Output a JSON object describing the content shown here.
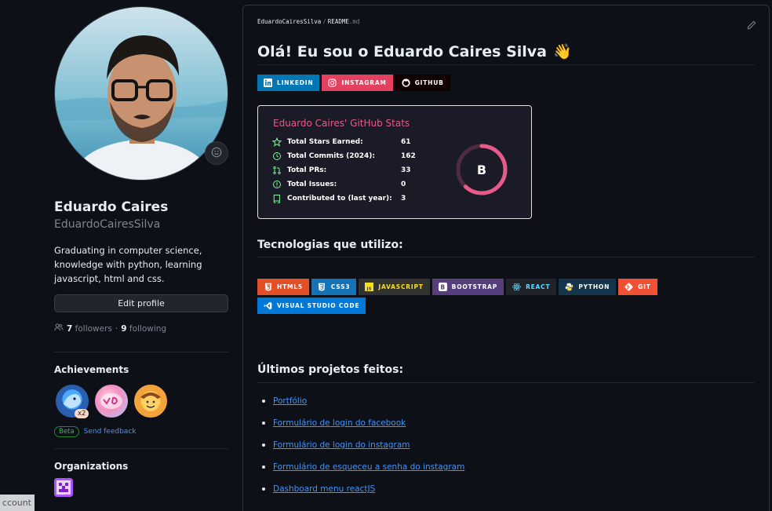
{
  "profile": {
    "full_name": "Eduardo Caires",
    "login": "EduardoCairesSilva",
    "bio": "Graduating in computer science, knowledge with python, learning javascript, html and css.",
    "edit_label": "Edit profile",
    "followers_count": "7",
    "followers_label": "followers",
    "following_count": "9",
    "following_label": "following",
    "separator": "·"
  },
  "achievements": {
    "title": "Achievements",
    "multiplier": "x2",
    "beta_label": "Beta",
    "feedback_label": "Send feedback"
  },
  "organizations": {
    "title": "Organizations"
  },
  "tooltip_fragment": "ccount",
  "readme": {
    "path_user": "EduardoCairesSilva",
    "path_sep": "/",
    "path_file": "README",
    "path_ext": ".md",
    "heading": "Olá! Eu sou o Eduardo Caires Silva",
    "wave_emoji": "👋",
    "social": [
      {
        "label": "LINKEDIN",
        "color": "#0077b5",
        "icon": "linkedin-icon"
      },
      {
        "label": "INSTAGRAM",
        "color": "#e4405f",
        "icon": "instagram-icon"
      },
      {
        "label": "GITHUB",
        "color": "#100000",
        "icon": "github-icon"
      }
    ],
    "stats": {
      "title": "Eduardo Caires' GitHub Stats",
      "rows": [
        {
          "label": "Total Stars Earned:",
          "value": "61",
          "icon": "star-icon"
        },
        {
          "label": "Total Commits (2024):",
          "value": "162",
          "icon": "history-icon"
        },
        {
          "label": "Total PRs:",
          "value": "33",
          "icon": "pull-request-icon"
        },
        {
          "label": "Total Issues:",
          "value": "0",
          "icon": "issue-icon"
        },
        {
          "label": "Contributed to (last year):",
          "value": "3",
          "icon": "repo-icon"
        }
      ],
      "rank": "B",
      "rank_progress": 0.62,
      "title_color": "#e85a8c",
      "ring_color": "#e85a8c"
    },
    "tech_heading": "Tecnologias que utilizo:",
    "tech": [
      {
        "label": "HTML5",
        "color": "#e34f26",
        "icon": "html5-icon"
      },
      {
        "label": "CSS3",
        "color": "#1572b6",
        "icon": "css3-icon"
      },
      {
        "label": "JAVASCRIPT",
        "color": "#323330",
        "icon": "javascript-icon"
      },
      {
        "label": "BOOTSTRAP",
        "color": "#563d7c",
        "icon": "bootstrap-icon"
      },
      {
        "label": "REACT",
        "color": "#20232a",
        "icon": "react-icon"
      },
      {
        "label": "PYTHON",
        "color": "#14354c",
        "icon": "python-icon"
      },
      {
        "label": "GIT",
        "color": "#f05033",
        "icon": "git-icon"
      },
      {
        "label": "VISUAL STUDIO CODE",
        "color": "#0078d7",
        "icon": "vscode-icon"
      }
    ],
    "projects_heading": "Últimos projetos feitos:",
    "projects": [
      {
        "label": "Portfólio"
      },
      {
        "label": "Formulário de login do facebook"
      },
      {
        "label": "Formulário de login do instagram"
      },
      {
        "label": "Formulário de esqueceu a senha do instagram"
      },
      {
        "label": "Dashboard menu reactJS"
      }
    ]
  }
}
